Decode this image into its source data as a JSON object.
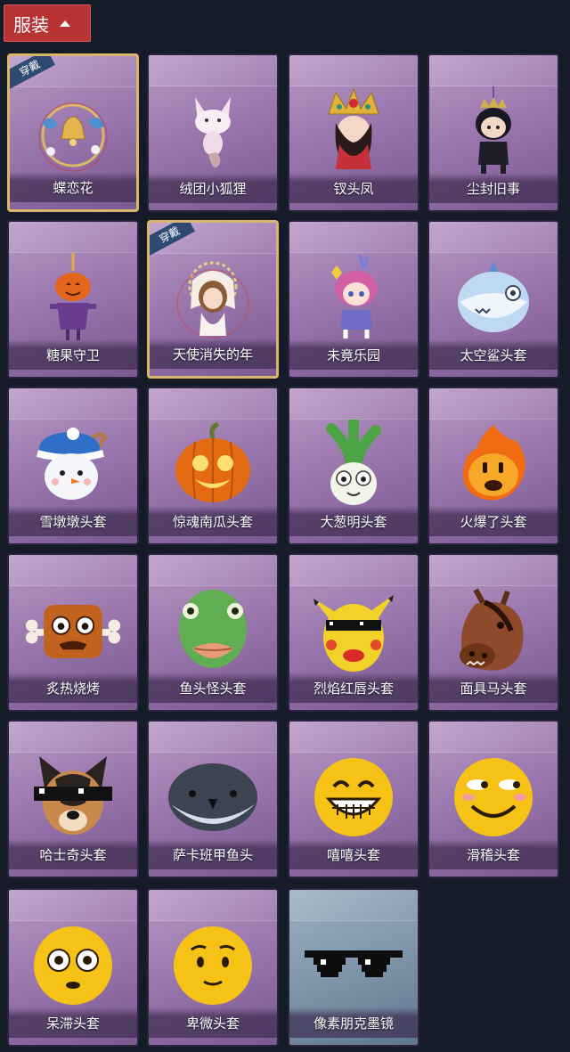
{
  "header": {
    "title": "服装"
  },
  "worn_tag": "穿戴",
  "items": [
    {
      "name": "蝶恋花",
      "worn": true,
      "icon": "butterfly-bell-ornament-icon",
      "style": "purple"
    },
    {
      "name": "绒团小狐狸",
      "worn": false,
      "icon": "fox-plush-icon",
      "style": "purple"
    },
    {
      "name": "钗头凤",
      "worn": false,
      "icon": "phoenix-crown-doll-icon",
      "style": "purple"
    },
    {
      "name": "尘封旧事",
      "worn": false,
      "icon": "dark-hair-doll-icon",
      "style": "purple"
    },
    {
      "name": "糖果守卫",
      "worn": false,
      "icon": "pumpkin-scarecrow-icon",
      "style": "purple"
    },
    {
      "name": "天使消失的年",
      "worn": true,
      "icon": "angel-girl-icon",
      "style": "purple"
    },
    {
      "name": "未竟乐园",
      "worn": false,
      "icon": "pink-hair-doll-icon",
      "style": "purple"
    },
    {
      "name": "太空鲨头套",
      "worn": false,
      "icon": "space-shark-head-icon",
      "style": "purple"
    },
    {
      "name": "雪墩墩头套",
      "worn": false,
      "icon": "snowman-head-icon",
      "style": "purple"
    },
    {
      "name": "惊魂南瓜头套",
      "worn": false,
      "icon": "jack-o-lantern-icon",
      "style": "purple"
    },
    {
      "name": "大葱明头套",
      "worn": false,
      "icon": "green-onion-head-icon",
      "style": "purple"
    },
    {
      "name": "火爆了头套",
      "worn": false,
      "icon": "fire-spirit-head-icon",
      "style": "purple"
    },
    {
      "name": "炙热烧烤",
      "worn": false,
      "icon": "bbq-meat-head-icon",
      "style": "purple"
    },
    {
      "name": "鱼头怪头套",
      "worn": false,
      "icon": "fish-head-mask-icon",
      "style": "purple"
    },
    {
      "name": "烈焰红唇头套",
      "worn": false,
      "icon": "yellow-lips-mask-icon",
      "style": "purple"
    },
    {
      "name": "面具马头套",
      "worn": false,
      "icon": "horse-mask-icon",
      "style": "purple"
    },
    {
      "name": "哈士奇头套",
      "worn": false,
      "icon": "husky-head-icon",
      "style": "purple"
    },
    {
      "name": "萨卡班甲鱼头",
      "worn": false,
      "icon": "sacabambaspis-head-icon",
      "style": "purple"
    },
    {
      "name": "嘻嘻头套",
      "worn": false,
      "icon": "grinning-emoji-head-icon",
      "style": "purple"
    },
    {
      "name": "滑稽头套",
      "worn": false,
      "icon": "funny-emoji-head-icon",
      "style": "purple"
    },
    {
      "name": "呆滞头套",
      "worn": false,
      "icon": "dazed-emoji-head-icon",
      "style": "purple"
    },
    {
      "name": "卑微头套",
      "worn": false,
      "icon": "humble-emoji-head-icon",
      "style": "purple"
    },
    {
      "name": "像素朋克墨镜",
      "worn": false,
      "icon": "pixel-sunglasses-icon",
      "style": "grey"
    }
  ]
}
